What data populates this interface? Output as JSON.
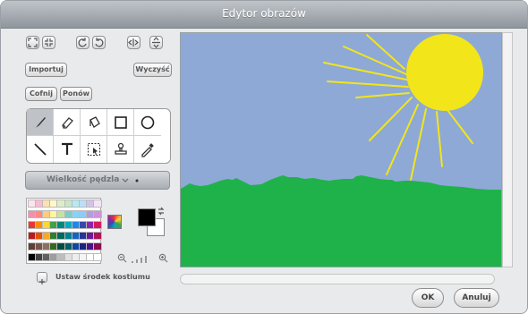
{
  "window": {
    "title": "Edytor obrazów"
  },
  "actions": {
    "import_label": "Importuj",
    "clear_label": "Wyczyść",
    "undo_label": "Cofnij",
    "redo_label": "Ponów"
  },
  "tools": {
    "top_row": [
      "grow-icon",
      "shrink-icon",
      "rotate-left-icon",
      "rotate-right-icon",
      "flip-horizontal-icon",
      "flip-vertical-icon"
    ],
    "paint": [
      "brush-icon",
      "eraser-icon",
      "fill-bucket-icon",
      "rectangle-icon",
      "ellipse-icon",
      "line-icon",
      "text-icon",
      "select-icon",
      "stamp-icon",
      "eyedropper-icon"
    ],
    "selected": "brush-icon"
  },
  "brush": {
    "label": "Wielkość pędzla"
  },
  "colors": {
    "palette_rows": [
      [
        "#fce4ec",
        "#f8bbd0",
        "#ffe0b2",
        "#fff9c4",
        "#dcedc8",
        "#c8e6c9",
        "#b2ebf2",
        "#bbdefb",
        "#d1c4e9",
        "#f3e5f5"
      ],
      [
        "#f48fb1",
        "#ff8a80",
        "#ffcc80",
        "#fff59d",
        "#c5e1a5",
        "#80cbc4",
        "#81d4fa",
        "#90caf9",
        "#b39ddb",
        "#ce93d8"
      ],
      [
        "#e53935",
        "#fb8c00",
        "#fdd835",
        "#43a047",
        "#00897b",
        "#00acc1",
        "#1e88e5",
        "#3949ab",
        "#8e24aa",
        "#d81b60"
      ],
      [
        "#b71c1c",
        "#e65100",
        "#f9a825",
        "#2e7d32",
        "#00695c",
        "#00838f",
        "#1565c0",
        "#283593",
        "#6a1b9a",
        "#ad1457"
      ],
      [
        "#5d4037",
        "#795548",
        "#8d6e63",
        "#33691e",
        "#004d40",
        "#006064",
        "#0d47a1",
        "#1a237e",
        "#4a148c",
        "#880e4f"
      ],
      [
        "#000000",
        "#424242",
        "#616161",
        "#9e9e9e",
        "#bdbdbd",
        "#e0e0e0",
        "#eeeeee",
        "#f5f5f5",
        "#ffffff",
        "#ffffff"
      ]
    ],
    "primary": "#000000",
    "secondary": "#ffffff",
    "sky": "#8ea9d6",
    "sun": "#f2e61a",
    "grass": "#1fb24a"
  },
  "costume": {
    "center_label": "Ustaw środek kostiumu"
  },
  "footer": {
    "ok_label": "OK",
    "cancel_label": "Anuluj"
  }
}
